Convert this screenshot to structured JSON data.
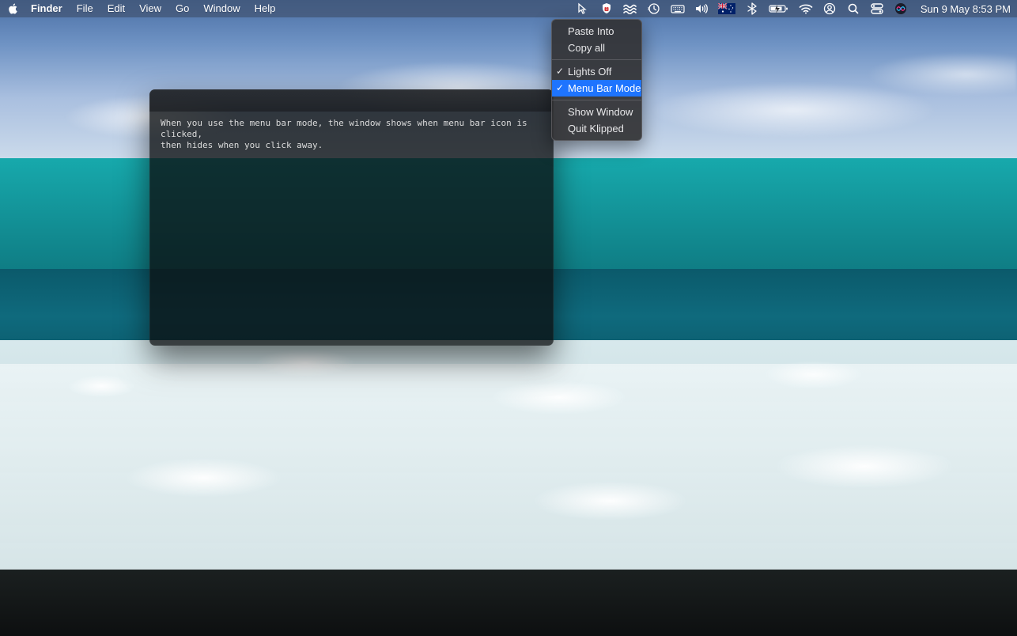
{
  "menubar": {
    "app_name": "Finder",
    "items": [
      "File",
      "Edit",
      "View",
      "Go",
      "Window",
      "Help"
    ],
    "clock": "Sun 9 May  8:53 PM",
    "status_icons": [
      "cursor-arrow-icon",
      "shield-badge-icon",
      "waves-icon",
      "time-machine-icon",
      "keyboard-icon",
      "volume-icon",
      "flag-au-icon",
      "bluetooth-icon",
      "battery-icon",
      "wifi-icon",
      "user-icon",
      "spotlight-icon",
      "control-center-icon",
      "siri-icon"
    ]
  },
  "dropdown": {
    "items": [
      {
        "label": "Paste Into",
        "checked": false,
        "selected": false
      },
      {
        "label": "Copy all",
        "checked": false,
        "selected": false
      }
    ],
    "items2": [
      {
        "label": "Lights Off",
        "checked": true,
        "selected": false
      },
      {
        "label": "Menu Bar Mode",
        "checked": true,
        "selected": true
      }
    ],
    "items3": [
      {
        "label": "Show Window",
        "checked": false,
        "selected": false
      },
      {
        "label": "Quit Klipped",
        "checked": false,
        "selected": false
      }
    ]
  },
  "window": {
    "text": "When you use the menu bar mode, the window shows when menu bar icon is clicked,\nthen hides when you click away."
  }
}
